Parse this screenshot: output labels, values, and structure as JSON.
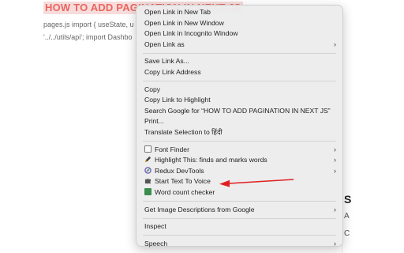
{
  "page": {
    "title": "HOW TO ADD PAGINATION IN NEXT JS",
    "code_line_1": "pages.js import { useState, u",
    "code_line_2": "'../../utils/api'; import Dashbo",
    "behind_s": "S",
    "behind_a": "A",
    "behind_c": "C"
  },
  "menu": {
    "items": {
      "open_new_tab": "Open Link in New Tab",
      "open_new_window": "Open Link in New Window",
      "open_incognito": "Open Link in Incognito Window",
      "open_link_as": "Open Link as",
      "save_link_as": "Save Link As...",
      "copy_link_address": "Copy Link Address",
      "copy": "Copy",
      "copy_link_highlight": "Copy Link to Highlight",
      "search_google": "Search Google for “HOW TO ADD PAGINATION IN NEXT JS”",
      "print": "Print...",
      "translate": "Translate Selection to हिंदी",
      "font_finder": "Font Finder",
      "highlight_this": "Highlight This: finds and marks words",
      "redux_devtools": "Redux DevTools",
      "start_text_to_voice": "Start Text To Voice",
      "word_count": "Word count checker",
      "image_descriptions": "Get Image Descriptions from Google",
      "inspect": "Inspect",
      "speech": "Speech"
    },
    "submenu_glyph": "›"
  },
  "colors": {
    "title_text": "#e8665e",
    "title_highlight": "#f7dcdc",
    "menu_bg": "#ececec",
    "arrow": "#e02020"
  },
  "icons": {
    "font_finder": "font-finder-icon",
    "highlight_this": "pen-icon",
    "redux_devtools": "redux-icon",
    "start_text_to_voice": "puzzle-icon",
    "word_count": "word-count-icon"
  }
}
